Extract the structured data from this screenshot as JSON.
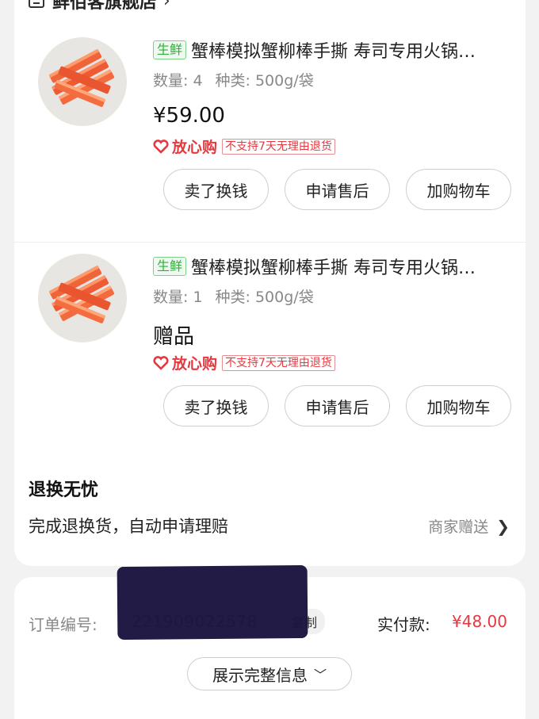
{
  "store": {
    "name": "鲜佰客旗舰店",
    "chevron": "›"
  },
  "products": [
    {
      "tag": "生鲜",
      "title": "蟹棒模拟蟹柳棒手撕 寿司专用火锅…",
      "qty_label": "数量: 4",
      "spec_label": "种类: 500g/袋",
      "price": "¥59.00",
      "assure": "放心购",
      "no_return": "不支持7天无理由退货",
      "buttons": [
        "卖了换钱",
        "申请售后",
        "加购物车"
      ]
    },
    {
      "tag": "生鲜",
      "title": "蟹棒模拟蟹柳棒手撕 寿司专用火锅…",
      "qty_label": "数量: 1",
      "spec_label": "种类: 500g/袋",
      "gift": "赠品",
      "assure": "放心购",
      "no_return": "不支持7天无理由退货",
      "buttons": [
        "卖了换钱",
        "申请售后",
        "加购物车"
      ]
    }
  ],
  "worry_free": {
    "title": "退换无忧",
    "desc": "完成退换货，自动申请理赔",
    "right": "商家赠送"
  },
  "order": {
    "number_label": "订单编号:",
    "number": "221909022578",
    "copy": "复制",
    "paid_label": "实付款:",
    "paid_value": "¥48.00",
    "expand": "展示完整信息"
  },
  "colors": {
    "accent_red": "#e5383f",
    "fresh_green": "#2fae3a",
    "redaction": "#1a1440"
  }
}
